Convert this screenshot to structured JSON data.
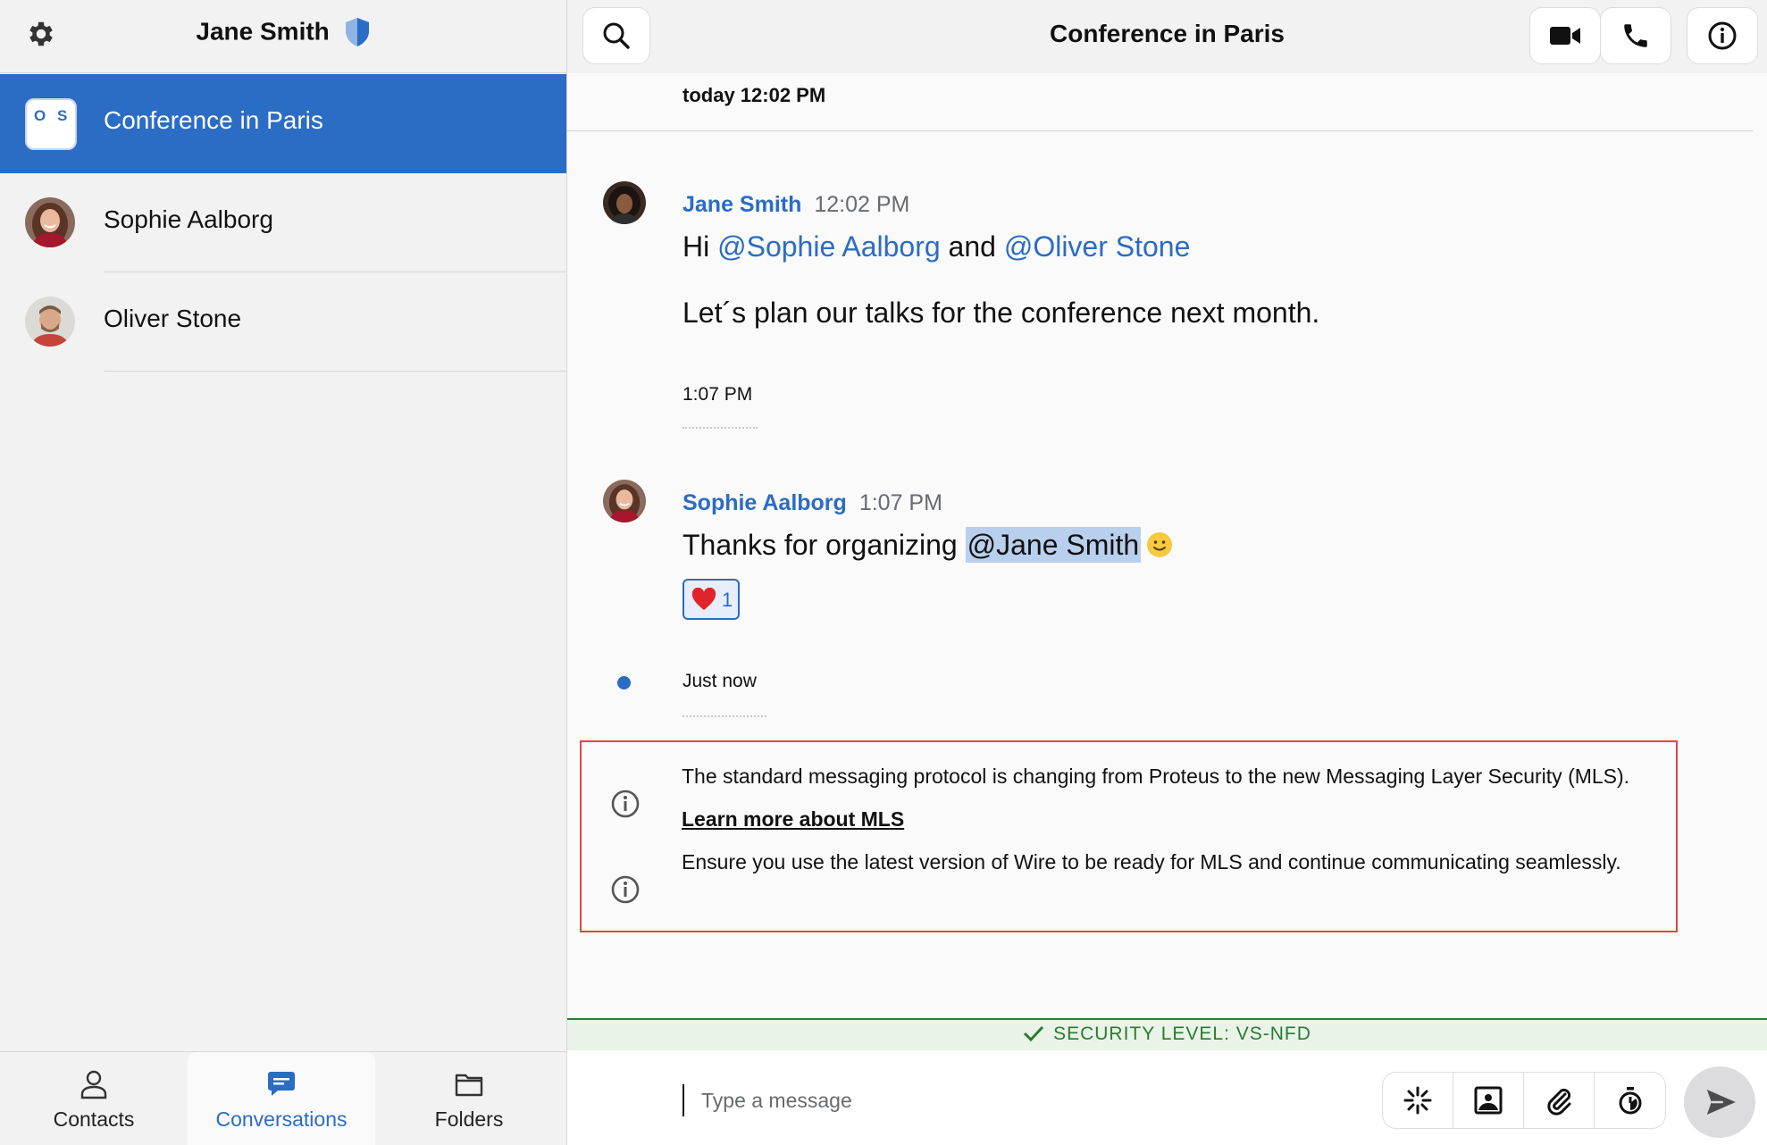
{
  "sidebar": {
    "user_name": "Jane Smith",
    "conversations": [
      {
        "label": "Conference in Paris",
        "active": true,
        "avatar_letters": [
          "O",
          "S"
        ]
      },
      {
        "label": "Sophie Aalborg",
        "active": false
      },
      {
        "label": "Oliver Stone",
        "active": false
      }
    ],
    "nav": [
      {
        "label": "Contacts",
        "icon": "person-icon"
      },
      {
        "label": "Conversations",
        "icon": "chat-bubble-icon",
        "active": true
      },
      {
        "label": "Folders",
        "icon": "folder-icon"
      }
    ]
  },
  "header": {
    "title": "Conference in Paris"
  },
  "timeline": {
    "day_marker": "today 12:02 PM",
    "message1": {
      "sender": "Jane Smith",
      "time": "12:02 PM",
      "line1_prefix": "Hi ",
      "mention1": "@Sophie Aalborg",
      "line1_mid": " and ",
      "mention2": "@Oliver Stone",
      "line2": "Let´s plan our talks for the conference next month."
    },
    "separator_time": "1:07 PM",
    "message2": {
      "sender": "Sophie Aalborg",
      "time": "1:07 PM",
      "text_prefix": "Thanks for organizing ",
      "mention_self": "@Jane Smith",
      "reaction_count": "1"
    },
    "separator_just_now": "Just now",
    "system_notice": {
      "line1": "The standard messaging protocol is changing from Proteus to the new Messaging Layer Security (MLS). ",
      "link": "Learn more about MLS",
      "line2": "Ensure you use the latest version of Wire to be ready for MLS and continue communicating seamlessly."
    }
  },
  "security_level": "SECURITY LEVEL: VS-NFD",
  "composer": {
    "placeholder": "Type a message"
  },
  "colors": {
    "accent": "#2b6cc4",
    "security_green": "#2b7a32",
    "highlight_border": "#e0473d"
  }
}
